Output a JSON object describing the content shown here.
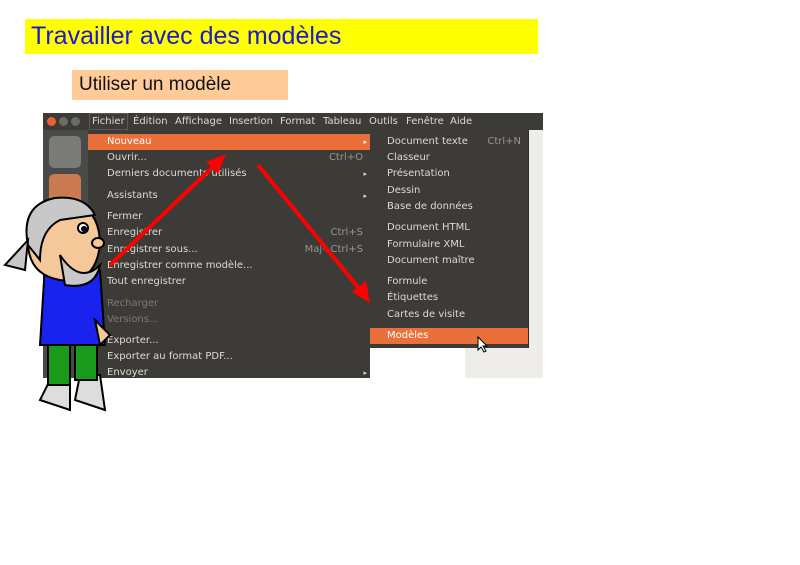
{
  "title": "Travailler avec des modèles",
  "subtitle": "Utiliser un modèle",
  "menubar": [
    "Fichier",
    "Édition",
    "Affichage",
    "Insertion",
    "Format",
    "Tableau",
    "Outils",
    "Fenêtre",
    "Aide"
  ],
  "file_menu": [
    {
      "label": "Nouveau",
      "arrow": "▸",
      "state": "highlighted"
    },
    {
      "label": "Ouvrir...",
      "shortcut": "Ctrl+O"
    },
    {
      "label": "Derniers documents utilisés",
      "arrow": "▸"
    },
    {
      "label": "Assistants",
      "arrow": "▸"
    },
    {
      "label": "Fermer"
    },
    {
      "label": "Enregistrer",
      "shortcut": "Ctrl+S"
    },
    {
      "label": "Enregistrer sous...",
      "shortcut": "Maj+Ctrl+S"
    },
    {
      "label": "Enregistrer comme modèle..."
    },
    {
      "label": "Tout enregistrer"
    },
    {
      "label": "Recharger",
      "state": "disabled"
    },
    {
      "label": "Versions...",
      "state": "disabled"
    },
    {
      "label": "Exporter..."
    },
    {
      "label": "Exporter au format PDF..."
    },
    {
      "label": "Envoyer",
      "arrow": "▸"
    }
  ],
  "new_submenu": [
    {
      "label": "Document texte",
      "shortcut": "Ctrl+N"
    },
    {
      "label": "Classeur"
    },
    {
      "label": "Présentation"
    },
    {
      "label": "Dessin"
    },
    {
      "label": "Base de données"
    },
    {
      "label": "Document HTML"
    },
    {
      "label": "Formulaire XML"
    },
    {
      "label": "Document maître"
    },
    {
      "label": "Formule"
    },
    {
      "label": "Étiquettes"
    },
    {
      "label": "Cartes de visite"
    },
    {
      "label": "Modèles",
      "state": "highlighted"
    }
  ],
  "colors": {
    "title_bg": "#ffff00",
    "title_text": "#1a1acc",
    "subtitle_bg": "#ffcc99",
    "menu_bg": "#3c3b37",
    "highlight": "#e9703a",
    "arrow": "#ff0000"
  }
}
